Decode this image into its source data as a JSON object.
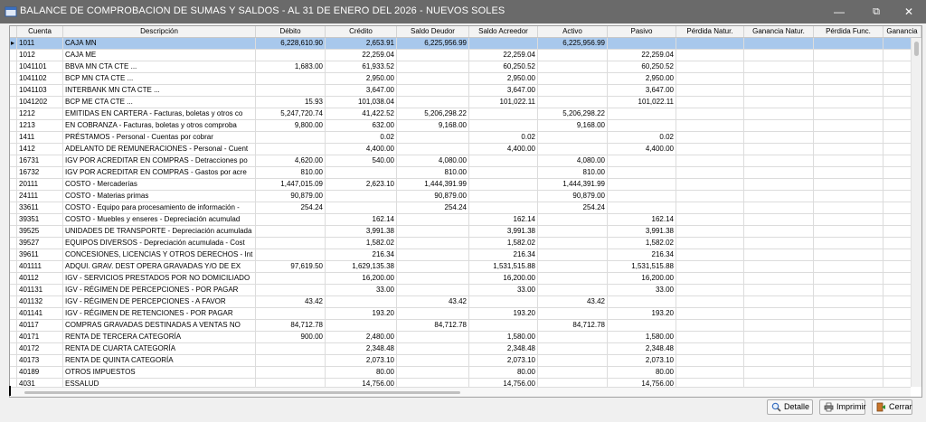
{
  "window": {
    "title": "BALANCE DE COMPROBACION DE SUMAS Y SALDOS - AL 31 DE ENERO DEL 2026 - NUEVOS SOLES",
    "minimize_glyph": "—",
    "maximize_glyph": "⧉",
    "close_glyph": "✕"
  },
  "grid": {
    "selected_indicator": "▸",
    "columns": [
      "Cuenta",
      "Descripción",
      "Débito",
      "Crédito",
      "Saldo Deudor",
      "Saldo Acreedor",
      "Activo",
      "Pasivo",
      "Pérdida Natur.",
      "Ganancia Natur.",
      "Pérdida Func.",
      "Ganancia"
    ],
    "rows": [
      [
        "1011",
        "CAJA MN",
        "6,228,610.90",
        "2,653.91",
        "6,225,956.99",
        "",
        "6,225,956.99",
        "",
        "",
        "",
        "",
        ""
      ],
      [
        "1012",
        "CAJA ME",
        "",
        "22,259.04",
        "",
        "22,259.04",
        "",
        "22,259.04",
        "",
        "",
        "",
        ""
      ],
      [
        "1041101",
        "BBVA MN CTA CTE  ...",
        "1,683.00",
        "61,933.52",
        "",
        "60,250.52",
        "",
        "60,250.52",
        "",
        "",
        "",
        ""
      ],
      [
        "1041102",
        "BCP MN CTA CTE  ...",
        "",
        "2,950.00",
        "",
        "2,950.00",
        "",
        "2,950.00",
        "",
        "",
        "",
        ""
      ],
      [
        "1041103",
        "INTERBANK MN CTA CTE ...",
        "",
        "3,647.00",
        "",
        "3,647.00",
        "",
        "3,647.00",
        "",
        "",
        "",
        ""
      ],
      [
        "1041202",
        "BCP ME CTA CTE  ...",
        "15.93",
        "101,038.04",
        "",
        "101,022.11",
        "",
        "101,022.11",
        "",
        "",
        "",
        ""
      ],
      [
        "1212",
        "EMITIDAS EN CARTERA - Facturas, boletas y otros co",
        "5,247,720.74",
        "41,422.52",
        "5,206,298.22",
        "",
        "5,206,298.22",
        "",
        "",
        "",
        "",
        ""
      ],
      [
        "1213",
        "EN COBRANZA - Facturas, boletas y otros comproba",
        "9,800.00",
        "632.00",
        "9,168.00",
        "",
        "9,168.00",
        "",
        "",
        "",
        "",
        ""
      ],
      [
        "1411",
        "PRÉSTAMOS - Personal - Cuentas por cobrar",
        "",
        "0.02",
        "",
        "0.02",
        "",
        "0.02",
        "",
        "",
        "",
        ""
      ],
      [
        "1412",
        "ADELANTO DE REMUNERACIONES - Personal - Cuent",
        "",
        "4,400.00",
        "",
        "4,400.00",
        "",
        "4,400.00",
        "",
        "",
        "",
        ""
      ],
      [
        "16731",
        "IGV POR ACREDITAR EN COMPRAS - Detracciones po",
        "4,620.00",
        "540.00",
        "4,080.00",
        "",
        "4,080.00",
        "",
        "",
        "",
        "",
        ""
      ],
      [
        "16732",
        "IGV POR ACREDITAR EN COMPRAS - Gastos por acre",
        "810.00",
        "",
        "810.00",
        "",
        "810.00",
        "",
        "",
        "",
        "",
        ""
      ],
      [
        "20111",
        "COSTO - Mercaderías",
        "1,447,015.09",
        "2,623.10",
        "1,444,391.99",
        "",
        "1,444,391.99",
        "",
        "",
        "",
        "",
        ""
      ],
      [
        "24111",
        "COSTO - Materias primas",
        "90,879.00",
        "",
        "90,879.00",
        "",
        "90,879.00",
        "",
        "",
        "",
        "",
        ""
      ],
      [
        "33611",
        "COSTO - Equipo para procesamiento de información -",
        "254.24",
        "",
        "254.24",
        "",
        "254.24",
        "",
        "",
        "",
        "",
        ""
      ],
      [
        "39351",
        "COSTO - Muebles y enseres - Depreciación acumulad",
        "",
        "162.14",
        "",
        "162.14",
        "",
        "162.14",
        "",
        "",
        "",
        ""
      ],
      [
        "39525",
        "UNIDADES DE TRANSPORTE - Depreciación acumulada",
        "",
        "3,991.38",
        "",
        "3,991.38",
        "",
        "3,991.38",
        "",
        "",
        "",
        ""
      ],
      [
        "39527",
        "EQUIPOS DIVERSOS - Depreciación acumulada - Cost",
        "",
        "1,582.02",
        "",
        "1,582.02",
        "",
        "1,582.02",
        "",
        "",
        "",
        ""
      ],
      [
        "39611",
        "CONCESIONES, LICENCIAS Y OTROS DERECHOS - Int",
        "",
        "216.34",
        "",
        "216.34",
        "",
        "216.34",
        "",
        "",
        "",
        ""
      ],
      [
        "401111",
        "ADQUI. GRAV. DEST OPERA GRAVADAS Y/O DE EX",
        "97,619.50",
        "1,629,135.38",
        "",
        "1,531,515.88",
        "",
        "1,531,515.88",
        "",
        "",
        "",
        ""
      ],
      [
        "40112",
        "IGV - SERVICIOS PRESTADOS POR NO DOMICILIADO",
        "",
        "16,200.00",
        "",
        "16,200.00",
        "",
        "16,200.00",
        "",
        "",
        "",
        ""
      ],
      [
        "401131",
        "IGV - RÉGIMEN DE PERCEPCIONES - POR PAGAR",
        "",
        "33.00",
        "",
        "33.00",
        "",
        "33.00",
        "",
        "",
        "",
        ""
      ],
      [
        "401132",
        "IGV - RÉGIMEN DE PERCEPCIONES - A FAVOR",
        "43.42",
        "",
        "43.42",
        "",
        "43.42",
        "",
        "",
        "",
        "",
        ""
      ],
      [
        "401141",
        "IGV - RÉGIMEN DE RETENCIONES - POR PAGAR",
        "",
        "193.20",
        "",
        "193.20",
        "",
        "193.20",
        "",
        "",
        "",
        ""
      ],
      [
        "40117",
        "COMPRAS GRAVADAS DESTINADAS A VENTAS NO",
        "84,712.78",
        "",
        "84,712.78",
        "",
        "84,712.78",
        "",
        "",
        "",
        "",
        ""
      ],
      [
        "40171",
        "RENTA DE TERCERA CATEGORÍA",
        "900.00",
        "2,480.00",
        "",
        "1,580.00",
        "",
        "1,580.00",
        "",
        "",
        "",
        ""
      ],
      [
        "40172",
        "RENTA DE CUARTA CATEGORÍA",
        "",
        "2,348.48",
        "",
        "2,348.48",
        "",
        "2,348.48",
        "",
        "",
        "",
        ""
      ],
      [
        "40173",
        "RENTA DE QUINTA CATEGORÍA",
        "",
        "2,073.10",
        "",
        "2,073.10",
        "",
        "2,073.10",
        "",
        "",
        "",
        ""
      ],
      [
        "40189",
        "OTROS IMPUESTOS",
        "",
        "80.00",
        "",
        "80.00",
        "",
        "80.00",
        "",
        "",
        "",
        ""
      ],
      [
        "4031",
        "ESSALUD",
        "",
        "14,756.00",
        "",
        "14,756.00",
        "",
        "14,756.00",
        "",
        "",
        "",
        ""
      ]
    ]
  },
  "buttons": {
    "detalle": "Detalle",
    "imprimir": "Imprimir",
    "cerrar": "Cerrar"
  },
  "colors": {
    "titlebar": "#6a6a6a",
    "selected_row": "#a8c8ec"
  },
  "icons": {
    "app": "window-icon",
    "detalle": "magnifier-icon",
    "imprimir": "printer-icon",
    "cerrar": "exit-door-icon"
  }
}
